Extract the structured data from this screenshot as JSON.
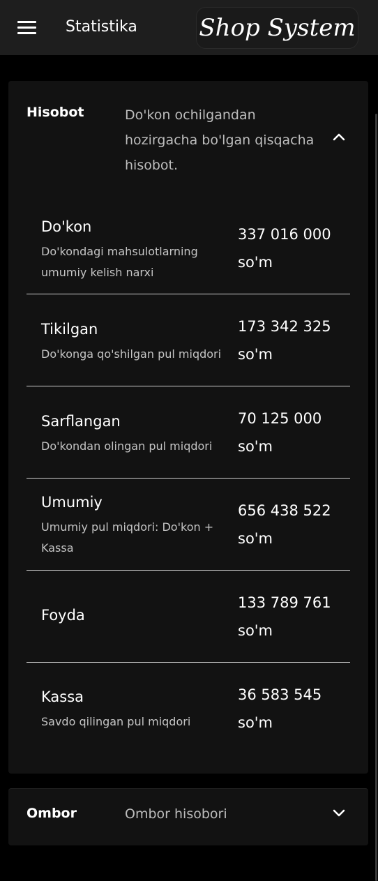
{
  "appbar": {
    "title": "Statistika",
    "brand": "Shop System",
    "menu_icon": "hamburger-menu-icon"
  },
  "report": {
    "title": "Hisobot",
    "description": "Do'kon ochilgandan hozirgacha bo'lgan qisqacha hisobot.",
    "expanded": true,
    "rows": [
      {
        "name": "Do'kon",
        "description": "Do'kondagi mahsulotlarning umumiy kelish narxi",
        "value": "337 016 000",
        "unit": "so'm"
      },
      {
        "name": "Tikilgan",
        "description": "Do'konga qo'shilgan pul miqdori",
        "value": "173 342 325",
        "unit": "so'm"
      },
      {
        "name": "Sarflangan",
        "description": "Do'kondan olingan pul miqdori",
        "value": "70 125 000",
        "unit": "so'm"
      },
      {
        "name": "Umumiy",
        "description": "Umumiy pul miqdori: Do'kon + Kassa",
        "value": "656 438 522",
        "unit": "so'm"
      },
      {
        "name": "Foyda",
        "description": "",
        "value": "133 789 761",
        "unit": "so'm"
      },
      {
        "name": "Kassa",
        "description": "Savdo qilingan pul miqdori",
        "value": "36 583 545",
        "unit": "so'm"
      }
    ]
  },
  "stock": {
    "title": "Ombor",
    "description": "Ombor hisobori",
    "expanded": false
  }
}
